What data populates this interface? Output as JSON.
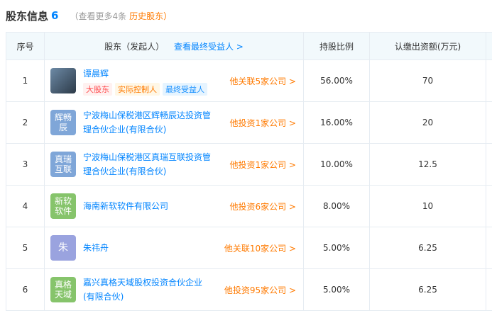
{
  "header": {
    "title": "股东信息",
    "count": "6",
    "more": "（查看更多4条",
    "history": "历史股东）"
  },
  "table": {
    "columns": {
      "index": "序号",
      "owner": "股东（发起人）",
      "owner_link": "查看最终受益人 >",
      "ratio": "持股比例",
      "amount": "认缴出资额(万元)"
    },
    "rows": [
      {
        "index": "1",
        "logo": "",
        "logo_type": "photo",
        "name": "谭晨辉",
        "tags": [
          "大股东",
          "实际控制人",
          "最终受益人"
        ],
        "relation": "他关联5家公司 >",
        "ratio": "56.00%",
        "amount": "70"
      },
      {
        "index": "2",
        "logo": "辉畅\n辰",
        "logo_type": "blue",
        "name": "宁波梅山保税港区辉畅辰达投资管理合伙企业(有限合伙)",
        "relation": "他投资1家公司 >",
        "ratio": "16.00%",
        "amount": "20"
      },
      {
        "index": "3",
        "logo": "真瑞\n互联",
        "logo_type": "blue",
        "name": "宁波梅山保税港区真瑞互联投资管理合伙企业(有限合伙)",
        "relation": "他投资1家公司 >",
        "ratio": "10.00%",
        "amount": "12.5"
      },
      {
        "index": "4",
        "logo": "新软\n软件",
        "logo_type": "green",
        "name": "海南新软软件有限公司",
        "relation": "他投资6家公司 >",
        "ratio": "8.00%",
        "amount": "10"
      },
      {
        "index": "5",
        "logo": "朱",
        "logo_type": "purple",
        "name": "朱祎舟",
        "relation": "他关联10家公司 >",
        "ratio": "5.00%",
        "amount": "6.25"
      },
      {
        "index": "6",
        "logo": "真格\n天域",
        "logo_type": "green",
        "name": "嘉兴真格天域股权投资合伙企业(有限合伙)",
        "relation": "他投资95家公司 >",
        "ratio": "5.00%",
        "amount": "6.25"
      }
    ]
  },
  "colors": {
    "accent": "#0084ff",
    "link_orange": "#ff7a00",
    "header_bg": "#f2f9fc"
  }
}
